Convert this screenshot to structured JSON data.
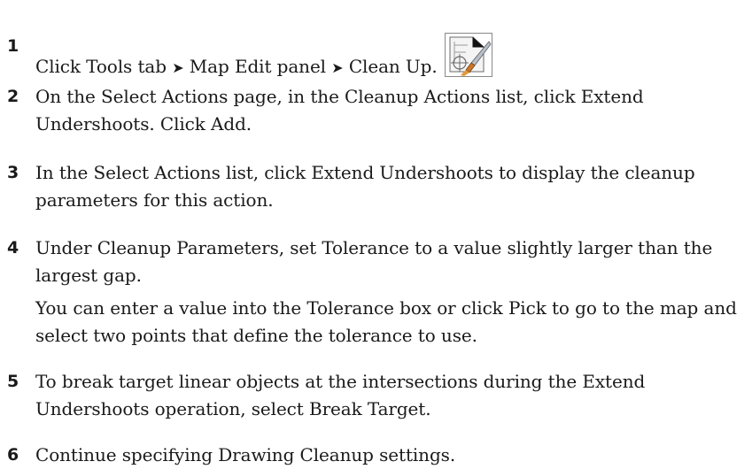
{
  "steps": [
    {
      "number": "1",
      "parts": {
        "a": "Click Tools tab",
        "sep1": "➤",
        "b": "Map Edit panel",
        "sep2": "➤",
        "c": "Clean Up."
      },
      "icon": "clean-up-icon"
    },
    {
      "number": "2",
      "text": "On the Select Actions page, in the Cleanup Actions list, click Extend Undershoots. Click Add."
    },
    {
      "number": "3",
      "text": "In the Select Actions list, click Extend Undershoots to display the cleanup parameters for this action."
    },
    {
      "number": "4",
      "text": "Under Cleanup Parameters, set Tolerance to a value slightly larger than the largest gap.",
      "note": "You can enter a value into the Tolerance box or click Pick to go to the map and select two points that define the tolerance to use."
    },
    {
      "number": "5",
      "text": "To break target linear objects at the intersections during the Extend Undershoots operation, select Break Target."
    },
    {
      "number": "6",
      "text": "Continue specifying Drawing Cleanup settings."
    }
  ]
}
